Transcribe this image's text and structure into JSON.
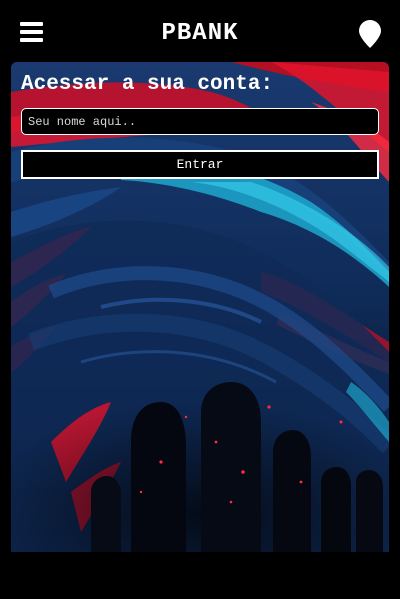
{
  "header": {
    "menu_icon": "hamburger-menu-icon",
    "brand": "PBANK",
    "location_icon": "map-pin-icon"
  },
  "login": {
    "title": "Acessar a sua conta:",
    "name_placeholder": "Seu nome aqui..",
    "name_value": "",
    "submit_label": "Entrar"
  },
  "colors": {
    "background": "#000000",
    "text": "#ffffff",
    "art_navy": "#0d2a55",
    "art_red": "#e8102a",
    "art_cyan": "#19c4e6"
  }
}
